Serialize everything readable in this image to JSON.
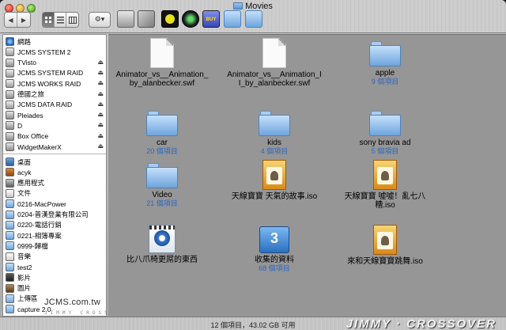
{
  "window": {
    "title": "Movies",
    "status": "12 個項目，43.02 GB 可用"
  },
  "toolbar": {
    "back_label": "◀",
    "forward_label": "▶",
    "views": [
      "icon-view",
      "list-view",
      "column-view"
    ],
    "action_label": "⚙▾"
  },
  "sidebar": {
    "devices": [
      {
        "label": "網路",
        "icon": "network-icon",
        "eject": false
      },
      {
        "label": "JCMS SYSTEM 2",
        "icon": "harddisk-icon",
        "eject": false
      },
      {
        "label": "TVisto",
        "icon": "disk-icon",
        "eject": true
      },
      {
        "label": "JCMS SYSTEM RAID",
        "icon": "harddisk-icon",
        "eject": true
      },
      {
        "label": "JCMS WORKS RAID",
        "icon": "harddisk-icon",
        "eject": true
      },
      {
        "label": "德國之旅",
        "icon": "disk-icon",
        "eject": true
      },
      {
        "label": "JCMS DATA RAID",
        "icon": "harddisk-icon",
        "eject": true
      },
      {
        "label": "Pleiades",
        "icon": "disk-icon",
        "eject": true
      },
      {
        "label": "D",
        "icon": "disk-icon",
        "eject": true
      },
      {
        "label": "Box Office",
        "icon": "disk-icon",
        "eject": true
      },
      {
        "label": "WidgetMakerX",
        "icon": "disk-icon",
        "eject": true
      }
    ],
    "places": [
      {
        "label": "桌面",
        "icon": "desktop-icon"
      },
      {
        "label": "acyk",
        "icon": "home-icon"
      },
      {
        "label": "應用程式",
        "icon": "applications-icon"
      },
      {
        "label": "文件",
        "icon": "documents-icon"
      },
      {
        "label": "0216-MacPower",
        "icon": "folder-icon"
      },
      {
        "label": "0204-普漢登業有限公司",
        "icon": "folder-icon"
      },
      {
        "label": "0220-電話行銷",
        "icon": "folder-icon"
      },
      {
        "label": "0221-相簿專案",
        "icon": "folder-icon"
      },
      {
        "label": "0999-歸檔",
        "icon": "folder-icon"
      },
      {
        "label": "音樂",
        "icon": "music-icon"
      },
      {
        "label": "test2",
        "icon": "folder-icon"
      },
      {
        "label": "影片",
        "icon": "movies-icon"
      },
      {
        "label": "圖片",
        "icon": "pictures-icon"
      },
      {
        "label": "上傳區",
        "icon": "folder-icon"
      },
      {
        "label": "capture 2.0",
        "icon": "folder-icon"
      }
    ]
  },
  "files": [
    {
      "name": "Animator_vs__Animation_by_alanbecker.swf",
      "lines": [
        "Animator_vs__Animation_",
        "by_alanbecker.swf"
      ],
      "sub": "",
      "icon": "document-icon"
    },
    {
      "name": "Animator_vs__Animation_II_by_alanbecker.swf",
      "lines": [
        "Animator_vs__Animation_I",
        "I_by_alanbecker.swf"
      ],
      "sub": "",
      "icon": "document-icon"
    },
    {
      "name": "apple",
      "lines": [
        "apple",
        ""
      ],
      "sub": "9 個項目",
      "icon": "folder-icon"
    },
    {
      "name": "car",
      "lines": [
        "car",
        ""
      ],
      "sub": "20 個項目",
      "icon": "folder-icon"
    },
    {
      "name": "kids",
      "lines": [
        "kids",
        ""
      ],
      "sub": "4 個項目",
      "icon": "folder-icon"
    },
    {
      "name": "sony bravia ad",
      "lines": [
        "sony bravia ad",
        ""
      ],
      "sub": "5 個項目",
      "icon": "folder-icon"
    },
    {
      "name": "Video",
      "lines": [
        "Video",
        ""
      ],
      "sub": "21 個項目",
      "icon": "folder-icon"
    },
    {
      "name": "天線寶寶 天氣的故事.iso",
      "lines": [
        "天線寶寶 天氣的故事.iso",
        ""
      ],
      "sub": "",
      "icon": "disk-image-icon"
    },
    {
      "name": "天線寶寶 噓噓！亂七八糟.iso",
      "lines": [
        "天線寶寶 噓噓！亂七八",
        "糟.iso"
      ],
      "sub": "",
      "icon": "disk-image-icon"
    },
    {
      "name": "比八爪椅更屌的東西",
      "lines": [
        "比八爪椅更屌的東西",
        ""
      ],
      "sub": "",
      "icon": "movie-icon"
    },
    {
      "name": "收集的資料",
      "lines": [
        "收集的資料",
        ""
      ],
      "sub": "68 個項目",
      "icon": "cd-folder-icon"
    },
    {
      "name": "來和天線寶寶跳舞.iso",
      "lines": [
        "來和天線寶寶跳舞.iso",
        ""
      ],
      "sub": "",
      "icon": "disk-image-icon"
    }
  ],
  "watermarks": {
    "left": "JCMS.com.tw",
    "left_small": "JIMMY CROSSOVER MEDIA STRATEGY",
    "right": "JIMMY · CROSSOVER"
  },
  "colors": {
    "main_bg": "#969696",
    "item_count": "#2a67c4"
  }
}
